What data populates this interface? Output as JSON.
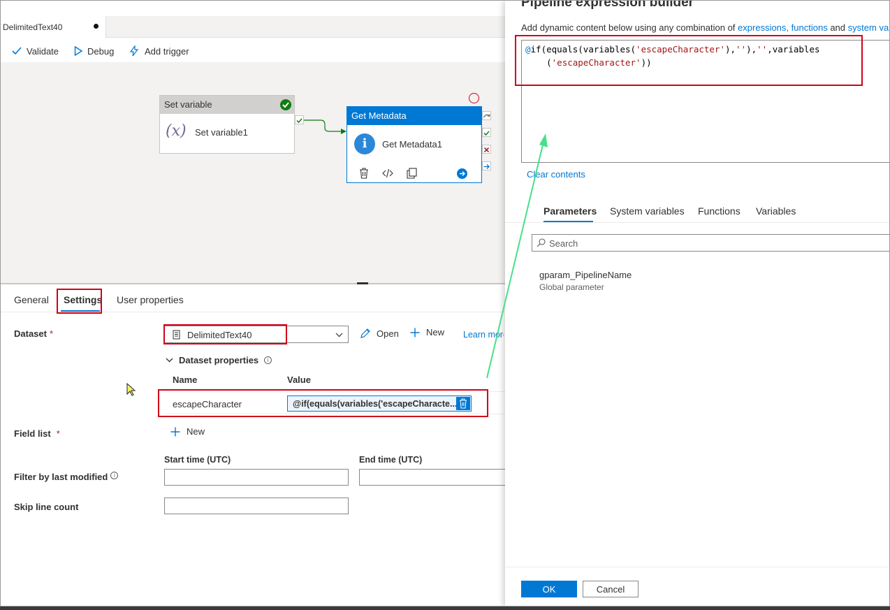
{
  "tab": {
    "title": "DelimitedText40"
  },
  "toolbar": {
    "validate": "Validate",
    "debug": "Debug",
    "add_trigger": "Add trigger"
  },
  "canvas": {
    "set_variable": {
      "type": "Set variable",
      "name": "Set variable1",
      "icon": "variable-x-icon"
    },
    "get_metadata": {
      "type": "Get Metadata",
      "name": "Get Metadata1",
      "icon": "info-icon"
    }
  },
  "properties": {
    "tabs": [
      "General",
      "Settings",
      "User properties"
    ],
    "active_tab": "Settings",
    "dataset_label": "Dataset",
    "dataset_value": "DelimitedText40",
    "open": "Open",
    "new": "New",
    "learn_more": "Learn more",
    "dataset_props": "Dataset properties",
    "col_name": "Name",
    "col_value": "Value",
    "param_name": "escapeCharacter",
    "param_value": "@if(equals(variables('escapeCharacte...",
    "field_list": "Field list",
    "field_new": "New",
    "start_time": "Start time (UTC)",
    "end_time": "End time (UTC)",
    "filter_label": "Filter by last modified",
    "skip_label": "Skip line count"
  },
  "builder": {
    "title": "Pipeline expression builder",
    "desc_prefix": "Add dynamic content below using any combination of",
    "link_expressions": "expressions,",
    "link_functions": "functions",
    "desc_and": "and",
    "link_system": "system va",
    "expression_line1_at": "@",
    "expression_line1_fn": "if(equals(variables(",
    "expression_line1_str": "'escapeCharacter'",
    "expression_line1_mid": "),",
    "expression_line1_str2": "''",
    "expression_line1_mid2": "),",
    "expression_line1_str3": "''",
    "expression_line1_end": ",variables",
    "expression_line2_pre": "    (",
    "expression_line2_str": "'escapeCharacter'",
    "expression_line2_end": "))",
    "clear": "Clear contents",
    "tabs": [
      "Parameters",
      "System variables",
      "Functions",
      "Variables"
    ],
    "active_tab": "Parameters",
    "search_placeholder": "Search",
    "param_name": "gparam_PipelineName",
    "param_type": "Global parameter",
    "ok": "OK",
    "cancel": "Cancel"
  },
  "colors": {
    "accent": "#0078d4",
    "success": "#107c10",
    "error": "#a4262c",
    "annotation_red": "#d0021b",
    "annotation_green": "#46e08a"
  }
}
